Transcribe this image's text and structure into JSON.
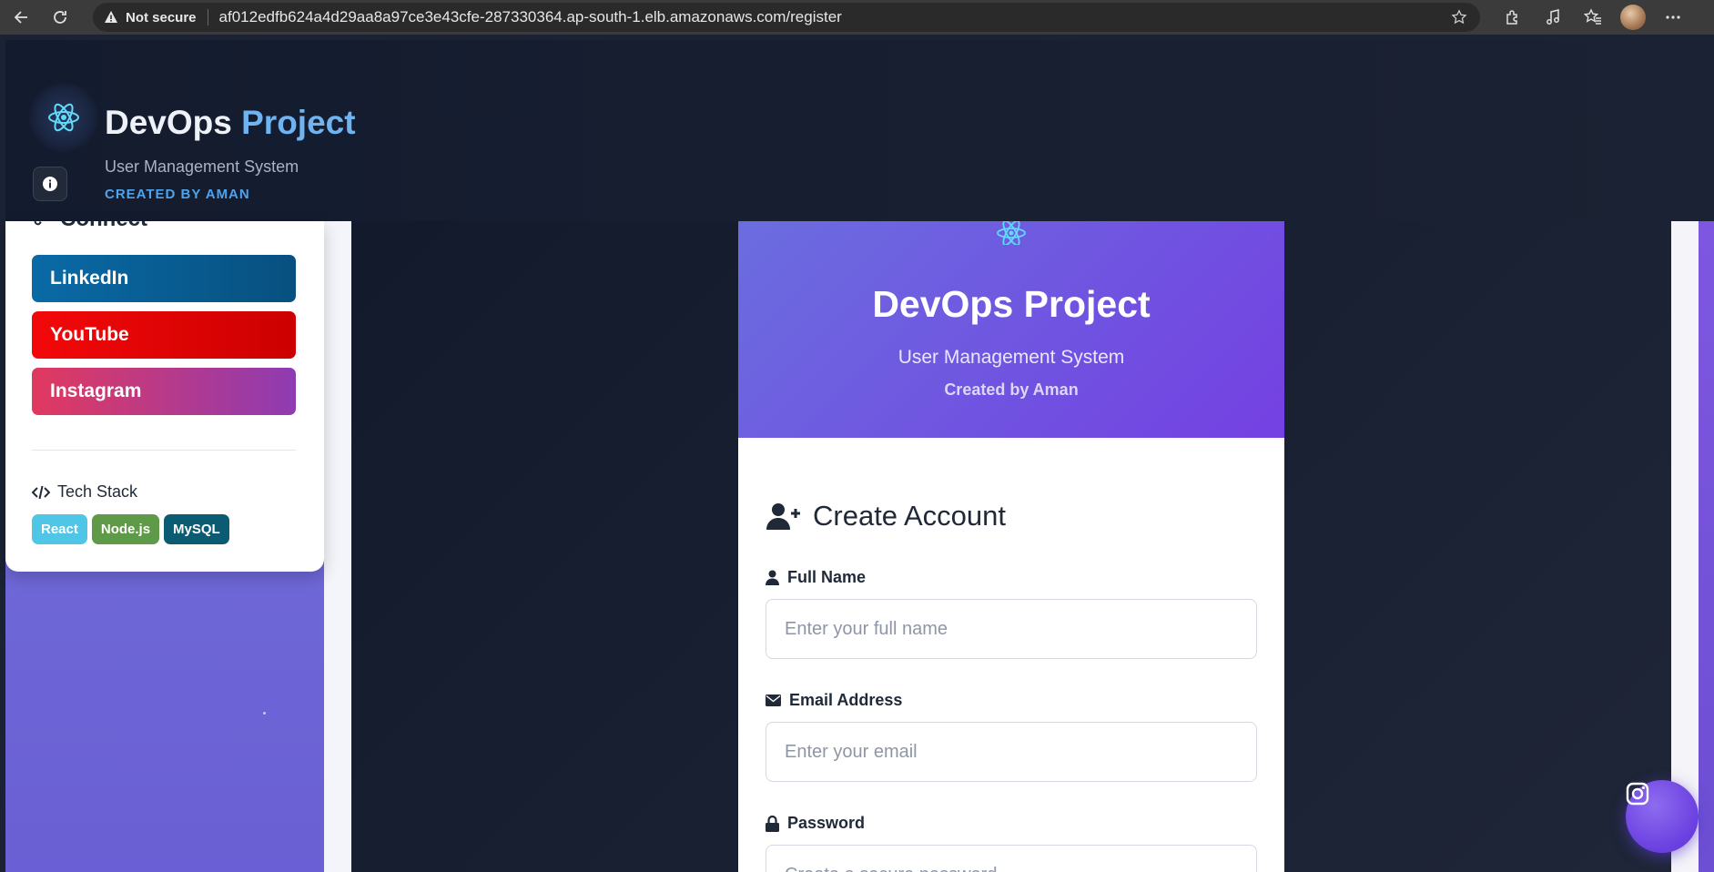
{
  "browser": {
    "not_secure": "Not secure",
    "url": "af012edfb624a4d29aa8a97ce3e43cfe-287330364.ap-south-1.elb.amazonaws.com/register"
  },
  "header": {
    "title_main": "DevOps",
    "title_accent": "Project",
    "subtitle": "User Management System",
    "creator": "CREATED BY AMAN"
  },
  "sidebar": {
    "connect_title": "Connect",
    "social_buttons": [
      {
        "label": "LinkedIn"
      },
      {
        "label": "YouTube"
      },
      {
        "label": "Instagram"
      }
    ],
    "tech_title": "Tech Stack",
    "tech_badges": [
      "React",
      "Node.js",
      "MySQL"
    ]
  },
  "register": {
    "hero_title": "DevOps Project",
    "hero_subtitle": "User Management System",
    "hero_creator": "Created by Aman",
    "form_title": "Create Account",
    "fields": [
      {
        "label": "Full Name",
        "placeholder": "Enter your full name"
      },
      {
        "label": "Email Address",
        "placeholder": "Enter your email"
      },
      {
        "label": "Password",
        "placeholder": "Create a secure password"
      }
    ]
  },
  "colors": {
    "accent_blue": "#6fb3f0",
    "hero_gradient_start": "#6b6ddf",
    "hero_gradient_end": "#7440e2",
    "linkedin": "#0a66a2",
    "youtube": "#ff0000",
    "react": "#4fc6e6",
    "node": "#5e9a47",
    "mysql": "#0b5b73"
  }
}
